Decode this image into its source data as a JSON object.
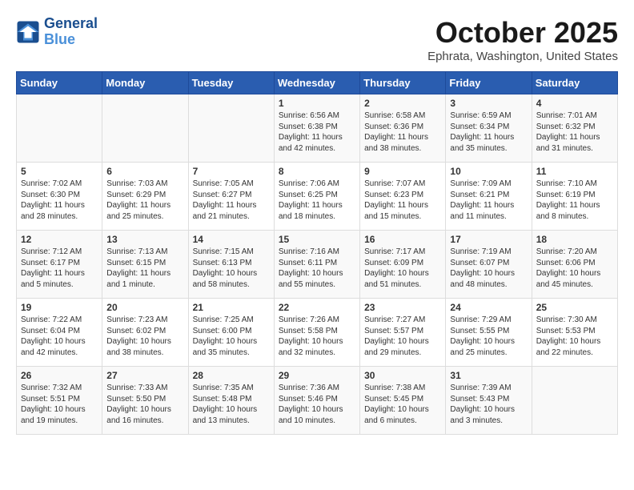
{
  "header": {
    "logo_line1": "General",
    "logo_line2": "Blue",
    "month": "October 2025",
    "location": "Ephrata, Washington, United States"
  },
  "weekdays": [
    "Sunday",
    "Monday",
    "Tuesday",
    "Wednesday",
    "Thursday",
    "Friday",
    "Saturday"
  ],
  "weeks": [
    [
      {
        "day": "",
        "info": ""
      },
      {
        "day": "",
        "info": ""
      },
      {
        "day": "",
        "info": ""
      },
      {
        "day": "1",
        "info": "Sunrise: 6:56 AM\nSunset: 6:38 PM\nDaylight: 11 hours\nand 42 minutes."
      },
      {
        "day": "2",
        "info": "Sunrise: 6:58 AM\nSunset: 6:36 PM\nDaylight: 11 hours\nand 38 minutes."
      },
      {
        "day": "3",
        "info": "Sunrise: 6:59 AM\nSunset: 6:34 PM\nDaylight: 11 hours\nand 35 minutes."
      },
      {
        "day": "4",
        "info": "Sunrise: 7:01 AM\nSunset: 6:32 PM\nDaylight: 11 hours\nand 31 minutes."
      }
    ],
    [
      {
        "day": "5",
        "info": "Sunrise: 7:02 AM\nSunset: 6:30 PM\nDaylight: 11 hours\nand 28 minutes."
      },
      {
        "day": "6",
        "info": "Sunrise: 7:03 AM\nSunset: 6:29 PM\nDaylight: 11 hours\nand 25 minutes."
      },
      {
        "day": "7",
        "info": "Sunrise: 7:05 AM\nSunset: 6:27 PM\nDaylight: 11 hours\nand 21 minutes."
      },
      {
        "day": "8",
        "info": "Sunrise: 7:06 AM\nSunset: 6:25 PM\nDaylight: 11 hours\nand 18 minutes."
      },
      {
        "day": "9",
        "info": "Sunrise: 7:07 AM\nSunset: 6:23 PM\nDaylight: 11 hours\nand 15 minutes."
      },
      {
        "day": "10",
        "info": "Sunrise: 7:09 AM\nSunset: 6:21 PM\nDaylight: 11 hours\nand 11 minutes."
      },
      {
        "day": "11",
        "info": "Sunrise: 7:10 AM\nSunset: 6:19 PM\nDaylight: 11 hours\nand 8 minutes."
      }
    ],
    [
      {
        "day": "12",
        "info": "Sunrise: 7:12 AM\nSunset: 6:17 PM\nDaylight: 11 hours\nand 5 minutes."
      },
      {
        "day": "13",
        "info": "Sunrise: 7:13 AM\nSunset: 6:15 PM\nDaylight: 11 hours\nand 1 minute."
      },
      {
        "day": "14",
        "info": "Sunrise: 7:15 AM\nSunset: 6:13 PM\nDaylight: 10 hours\nand 58 minutes."
      },
      {
        "day": "15",
        "info": "Sunrise: 7:16 AM\nSunset: 6:11 PM\nDaylight: 10 hours\nand 55 minutes."
      },
      {
        "day": "16",
        "info": "Sunrise: 7:17 AM\nSunset: 6:09 PM\nDaylight: 10 hours\nand 51 minutes."
      },
      {
        "day": "17",
        "info": "Sunrise: 7:19 AM\nSunset: 6:07 PM\nDaylight: 10 hours\nand 48 minutes."
      },
      {
        "day": "18",
        "info": "Sunrise: 7:20 AM\nSunset: 6:06 PM\nDaylight: 10 hours\nand 45 minutes."
      }
    ],
    [
      {
        "day": "19",
        "info": "Sunrise: 7:22 AM\nSunset: 6:04 PM\nDaylight: 10 hours\nand 42 minutes."
      },
      {
        "day": "20",
        "info": "Sunrise: 7:23 AM\nSunset: 6:02 PM\nDaylight: 10 hours\nand 38 minutes."
      },
      {
        "day": "21",
        "info": "Sunrise: 7:25 AM\nSunset: 6:00 PM\nDaylight: 10 hours\nand 35 minutes."
      },
      {
        "day": "22",
        "info": "Sunrise: 7:26 AM\nSunset: 5:58 PM\nDaylight: 10 hours\nand 32 minutes."
      },
      {
        "day": "23",
        "info": "Sunrise: 7:27 AM\nSunset: 5:57 PM\nDaylight: 10 hours\nand 29 minutes."
      },
      {
        "day": "24",
        "info": "Sunrise: 7:29 AM\nSunset: 5:55 PM\nDaylight: 10 hours\nand 25 minutes."
      },
      {
        "day": "25",
        "info": "Sunrise: 7:30 AM\nSunset: 5:53 PM\nDaylight: 10 hours\nand 22 minutes."
      }
    ],
    [
      {
        "day": "26",
        "info": "Sunrise: 7:32 AM\nSunset: 5:51 PM\nDaylight: 10 hours\nand 19 minutes."
      },
      {
        "day": "27",
        "info": "Sunrise: 7:33 AM\nSunset: 5:50 PM\nDaylight: 10 hours\nand 16 minutes."
      },
      {
        "day": "28",
        "info": "Sunrise: 7:35 AM\nSunset: 5:48 PM\nDaylight: 10 hours\nand 13 minutes."
      },
      {
        "day": "29",
        "info": "Sunrise: 7:36 AM\nSunset: 5:46 PM\nDaylight: 10 hours\nand 10 minutes."
      },
      {
        "day": "30",
        "info": "Sunrise: 7:38 AM\nSunset: 5:45 PM\nDaylight: 10 hours\nand 6 minutes."
      },
      {
        "day": "31",
        "info": "Sunrise: 7:39 AM\nSunset: 5:43 PM\nDaylight: 10 hours\nand 3 minutes."
      },
      {
        "day": "",
        "info": ""
      }
    ]
  ]
}
